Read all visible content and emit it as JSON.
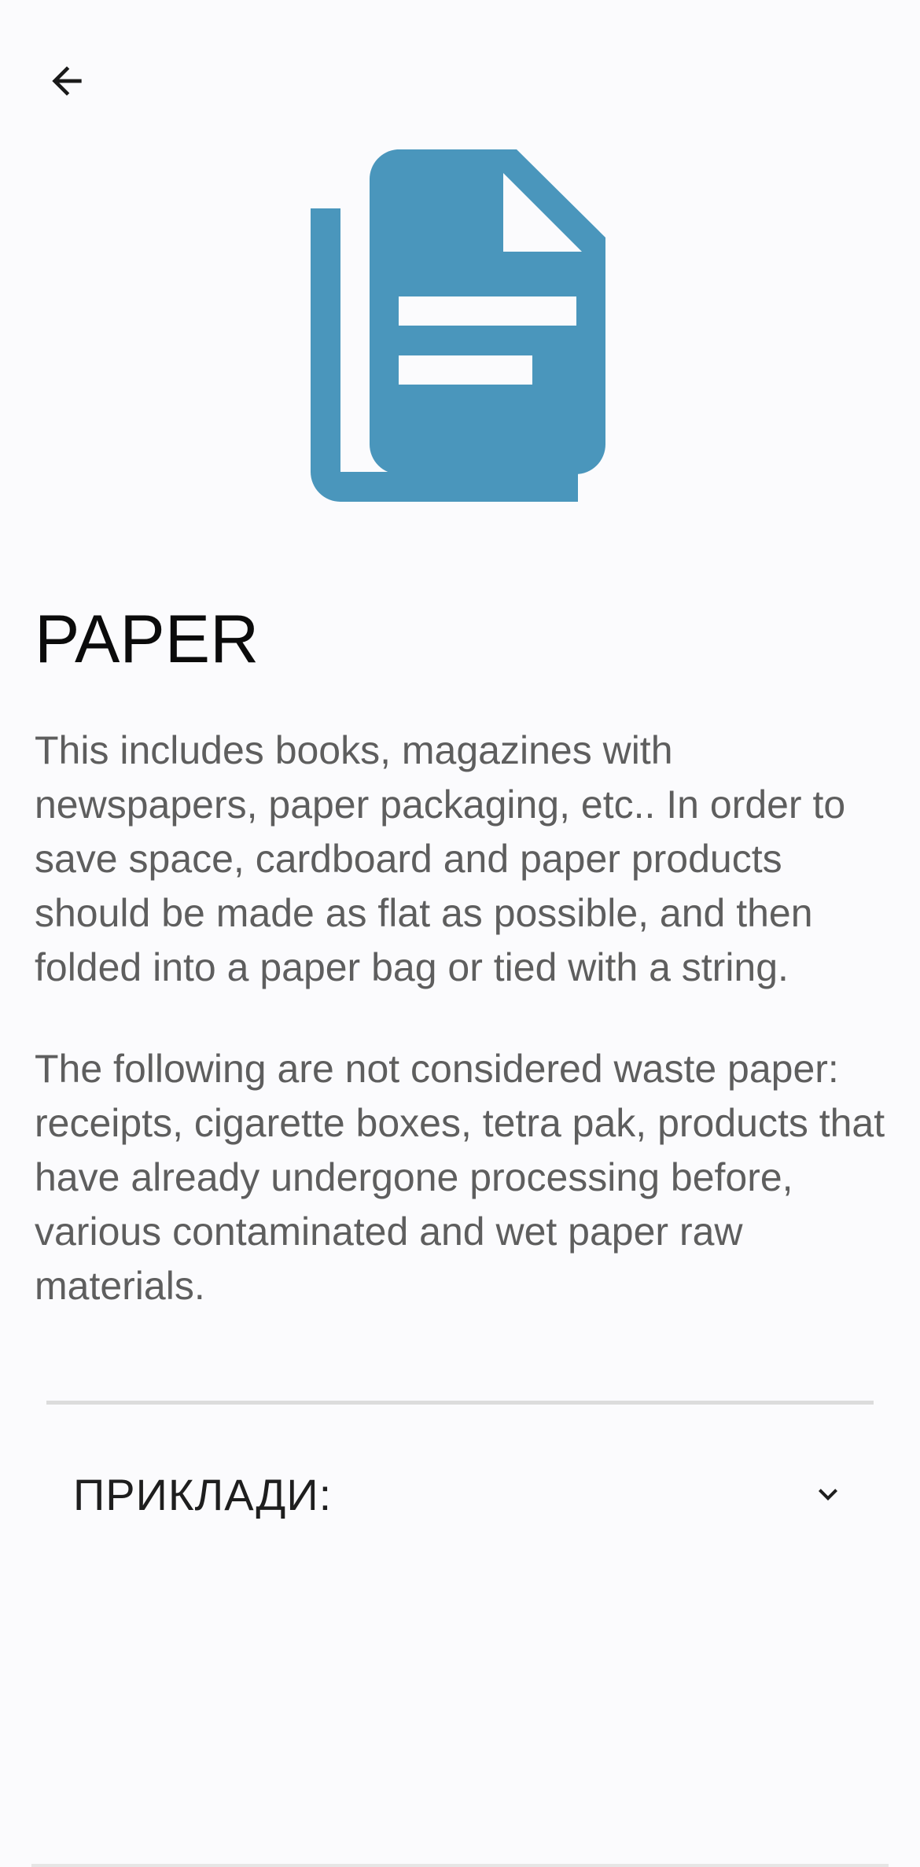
{
  "header": {
    "back_icon": "arrow-left-icon"
  },
  "hero": {
    "icon": "document-copy-icon",
    "color": "#4a96bc"
  },
  "content": {
    "title": "PAPER",
    "paragraph_1": "This includes books, magazines with newspapers, paper packaging, etc.. In order to save space, cardboard and paper products should be made as flat as possible, and then folded into a paper bag or tied with a string.",
    "paragraph_2": "The following are not considered waste paper: receipts, cigarette boxes, tetra pak, products that have already undergone processing before, various contaminated and wet paper raw materials."
  },
  "examples": {
    "label": "ПРИКЛАДИ:",
    "chevron_icon": "chevron-down-icon",
    "expanded": false
  }
}
